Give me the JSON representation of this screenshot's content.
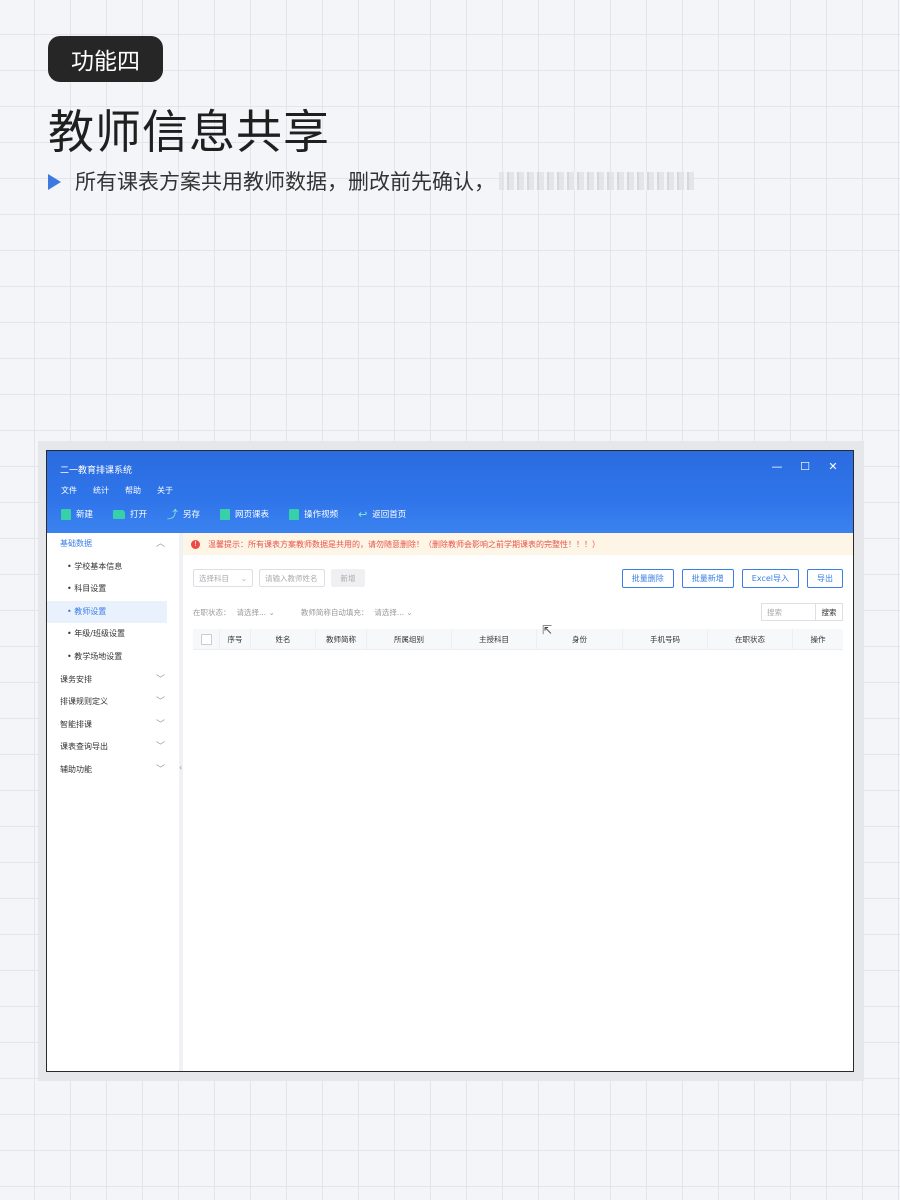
{
  "badge": "功能四",
  "headline": "教师信息共享",
  "subline": "所有课表方案共用教师数据，删改前先确认，",
  "window": {
    "title": "二一教育排课系统",
    "controls": {
      "minimize": "—",
      "maximize": "☐",
      "close": "✕"
    },
    "menu": [
      "文件",
      "统计",
      "帮助",
      "关于"
    ],
    "toolbar": [
      {
        "label": "新建",
        "icon": "file-icon"
      },
      {
        "label": "打开",
        "icon": "folder-icon"
      },
      {
        "label": "另存",
        "icon": "upload-icon"
      },
      {
        "label": "网页课表",
        "icon": "calendar-icon"
      },
      {
        "label": "操作视频",
        "icon": "play-icon"
      },
      {
        "label": "返回首页",
        "icon": "back-icon"
      }
    ]
  },
  "sidebar": {
    "groups": [
      {
        "label": "基础数据",
        "expanded": true,
        "children": [
          {
            "label": "学校基本信息",
            "active": false
          },
          {
            "label": "科目设置",
            "active": false
          },
          {
            "label": "教师设置",
            "active": true
          },
          {
            "label": "年级/班级设置",
            "active": false
          },
          {
            "label": "教学场地设置",
            "active": false
          }
        ]
      },
      {
        "label": "课务安排",
        "expanded": false
      },
      {
        "label": "排课规则定义",
        "expanded": false
      },
      {
        "label": "智能排课",
        "expanded": false
      },
      {
        "label": "课表查询导出",
        "expanded": false
      },
      {
        "label": "辅助功能",
        "expanded": false
      }
    ]
  },
  "notice": "温馨提示：所有课表方案教师数据是共用的，请勿随意删除！（删除教师会影响之前学期课表的完整性！！！）",
  "filters": {
    "subject_select": "选择科目",
    "teacher_name_placeholder": "请输入教师姓名",
    "add_button": "新增"
  },
  "actions": [
    "批量删除",
    "批量新增",
    "Excel导入",
    "导出"
  ],
  "filters2": {
    "status_label": "在职状态：",
    "status_value": "请选择...",
    "abbr_label": "教师简称自动填充：",
    "abbr_value": "请选择..."
  },
  "search": {
    "placeholder": "搜索",
    "button": "搜索"
  },
  "table": {
    "columns": [
      "序号",
      "姓名",
      "教师简称",
      "所属组别",
      "主授科目",
      "身份",
      "手机号码",
      "在职状态",
      "操作"
    ]
  },
  "colors": {
    "primary": "#3b7ee8",
    "header_blue": "#2f75ea",
    "warning": "#e8544a",
    "accent_green": "#37d1a9"
  }
}
